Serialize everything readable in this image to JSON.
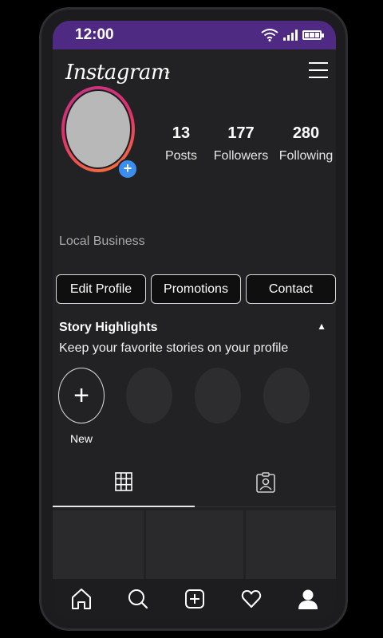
{
  "status_bar": {
    "time": "12:00"
  },
  "header": {
    "brand": "Instagram",
    "dropdown_icon": "chevron-down-icon",
    "menu_icon": "hamburger-menu-icon"
  },
  "profile": {
    "stats": [
      {
        "value": "13",
        "label": "Posts"
      },
      {
        "value": "177",
        "label": "Followers"
      },
      {
        "value": "280",
        "label": "Following"
      }
    ],
    "category": "Local Business",
    "add_icon": "plus-icon"
  },
  "actions": [
    "Edit Profile",
    "Promotions",
    "Contact"
  ],
  "highlights": {
    "title": "Story Highlights",
    "subtitle": "Keep your favorite stories on your profile",
    "new_label": "New",
    "collapse_icon": "chevron-up-icon"
  },
  "tabs": [
    {
      "icon": "grid-icon",
      "active": true
    },
    {
      "icon": "tagged-icon",
      "active": false
    }
  ],
  "nav": [
    "home-icon",
    "search-icon",
    "add-post-icon",
    "heart-icon",
    "profile-icon"
  ],
  "colors": {
    "status_bar": "#4f2a83",
    "badge": "#3b8ef0",
    "ring_start": "#c13584",
    "ring_end": "#f77737"
  }
}
